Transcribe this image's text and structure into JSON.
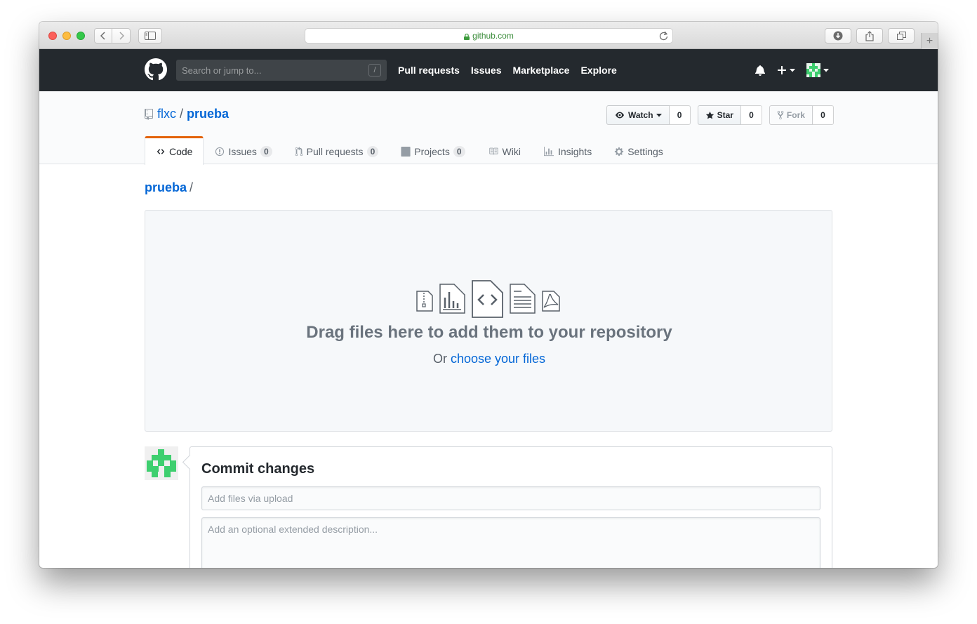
{
  "browser": {
    "url": "github.com",
    "traffic_lights": [
      "close",
      "minimize",
      "zoom"
    ],
    "icons": [
      "back-icon",
      "forward-icon",
      "sidebar-icon",
      "lock-icon",
      "reload-icon",
      "download-icon",
      "share-icon",
      "tabs-icon",
      "new-tab-icon"
    ]
  },
  "header": {
    "search_placeholder": "Search or jump to...",
    "search_shortcut": "/",
    "nav": [
      "Pull requests",
      "Issues",
      "Marketplace",
      "Explore"
    ],
    "icons": [
      "github-logo-icon",
      "bell-icon",
      "plus-icon",
      "avatar"
    ]
  },
  "repo": {
    "owner": "flxc",
    "separator": "/",
    "name": "prueba",
    "actions": {
      "watch_label": "Watch",
      "watch_count": "0",
      "star_label": "Star",
      "star_count": "0",
      "fork_label": "Fork",
      "fork_count": "0"
    },
    "tabs": [
      {
        "label": "Code",
        "icon": "code-icon",
        "selected": true
      },
      {
        "label": "Issues",
        "icon": "issue-icon",
        "counter": "0"
      },
      {
        "label": "Pull requests",
        "icon": "pull-request-icon",
        "counter": "0"
      },
      {
        "label": "Projects",
        "icon": "project-icon",
        "counter": "0"
      },
      {
        "label": "Wiki",
        "icon": "book-icon"
      },
      {
        "label": "Insights",
        "icon": "graph-icon"
      },
      {
        "label": "Settings",
        "icon": "gear-icon"
      }
    ]
  },
  "breadcrumb": {
    "repo": "prueba",
    "separator": "/"
  },
  "dropzone": {
    "title": "Drag files here to add them to your repository",
    "prefix": "Or",
    "link": "choose your files",
    "icons": [
      "file-zip-icon",
      "file-chart-icon",
      "file-code-icon",
      "file-text-icon",
      "file-pdf-icon"
    ]
  },
  "commit": {
    "title": "Commit changes",
    "summary_placeholder": "Add files via upload",
    "description_placeholder": "Add an optional extended description..."
  },
  "colors": {
    "header_bg": "#24292e",
    "link": "#0366d6",
    "selected_tab_accent": "#e36209",
    "avatar_green": "#3ecf6f"
  }
}
